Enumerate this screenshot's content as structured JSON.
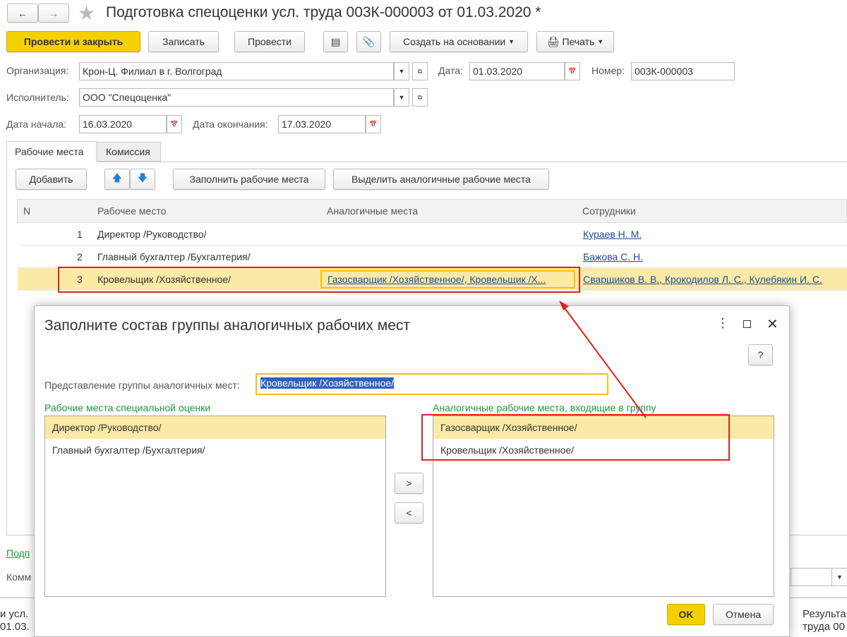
{
  "title": "Подготовка спецоценки усл. труда 003К-000003 от 01.03.2020 *",
  "toolbar": {
    "post_close": "Провести и закрыть",
    "save": "Записать",
    "post": "Провести",
    "create_based": "Создать на основании",
    "print": "Печать"
  },
  "form": {
    "org_label": "Организация:",
    "org_value": "Крон-Ц. Филиал в г. Волгоград",
    "date_label": "Дата:",
    "date_value": "01.03.2020",
    "number_label": "Номер:",
    "number_value": "003К-000003",
    "executor_label": "Исполнитель:",
    "executor_value": "ООО \"Спецоценка\"",
    "start_label": "Дата начала:",
    "start_value": "16.03.2020",
    "end_label": "Дата окончания:",
    "end_value": "17.03.2020"
  },
  "tabs": [
    "Рабочие места",
    "Комиссия"
  ],
  "table_toolbar": {
    "add": "Добавить",
    "fill": "Заполнить рабочие места",
    "select_similar": "Выделить аналогичные рабочие места"
  },
  "table": {
    "headers": [
      "N",
      "Рабочее место",
      "Аналогичные места",
      "Сотрудники"
    ],
    "rows": [
      {
        "n": "1",
        "place": "Директор /Руководство/",
        "similar": "",
        "employees": "Кураев Н. М."
      },
      {
        "n": "2",
        "place": "Главный бухгалтер /Бухгалтерия/",
        "similar": "",
        "employees": "Бажова С. Н."
      },
      {
        "n": "3",
        "place": "Кровельщик /Хозяйственное/",
        "similar": "Газосварщик /Хозяйственное/, Кровельщик /Х...",
        "employees": "Сварщиков В. В., Крокодилов Л. С., Кулебякин И. С."
      }
    ]
  },
  "footer": {
    "sign_link": "Подп",
    "comment_label": "Комм",
    "bottom_left_1": "и усл.",
    "bottom_left_2": "01.03.",
    "bottom_right_1": "Результа",
    "bottom_right_2": "труда 00"
  },
  "dialog": {
    "title": "Заполните состав группы аналогичных рабочих мест",
    "help": "?",
    "group_label": "Представление группы аналогичных мест:",
    "group_value": "Кровельщик /Хозяйственное/",
    "left_title": "Рабочие места специальной оценки",
    "left_items": [
      "Директор /Руководство/",
      "Главный бухгалтер /Бухгалтерия/"
    ],
    "right_title": "Аналогичные рабочие места, входящие в группу",
    "right_items": [
      "Газосварщик /Хозяйственное/",
      "Кровельщик /Хозяйственное/"
    ],
    "move_right": ">",
    "move_left": "<",
    "ok": "OK",
    "cancel": "Отмена"
  },
  "colors": {
    "accent_yellow": "#f5d000",
    "selection": "#fbe9a6",
    "green": "#1a9a3a",
    "link": "#1a4f9c",
    "annotation": "#e02020"
  }
}
